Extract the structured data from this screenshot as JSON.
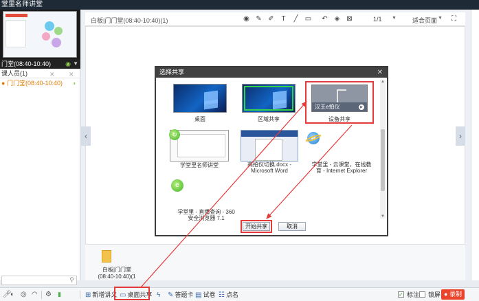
{
  "app": {
    "title": "堂里名师讲堂"
  },
  "left": {
    "session_status": "门堂(08:40-10:40)",
    "members_header": "课人员(1)",
    "member_name": "门门堂(08:40-10:40)"
  },
  "doc": {
    "title": "白板|门门堂(08:40-10:40)(1)",
    "page_indicator": "1/1",
    "fit_label": "适合页面",
    "file_name": "白板|门门堂\n(08:40-10:40)(1"
  },
  "dialog": {
    "title": "选择共享",
    "items": [
      {
        "label": "桌面"
      },
      {
        "label": "区域共享"
      },
      {
        "label": "设备共享",
        "device_name": "汉王e拍仪"
      },
      {
        "label": "学堂里名师讲堂"
      },
      {
        "label": "高拍仪切换.docx -\nMicrosoft Word"
      },
      {
        "label": "学堂里 - 云课堂，在线教\n育 - Internet Explorer"
      },
      {
        "label": "学堂里 - 直播查询 - 360\n安全浏览器 7.1"
      }
    ],
    "start_button": "开始共享",
    "cancel_button": "取消"
  },
  "bottom": {
    "new_handout": "新增讲义",
    "desktop_share": "桌面共享",
    "answer_card": "答题卡",
    "exam": "试卷",
    "roll_call": "点名",
    "annotate": "标注",
    "lock_screen": "锁屏",
    "record": "录制"
  },
  "colors": {
    "accent_red": "#e53a3a",
    "record_red": "#e8452c",
    "green": "#33d24b"
  }
}
